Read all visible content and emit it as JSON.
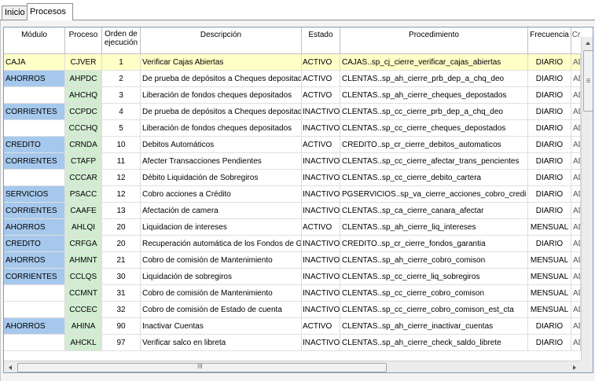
{
  "tabs": [
    {
      "label": "Inicio",
      "active": false
    },
    {
      "label": "Procesos",
      "active": true
    }
  ],
  "table": {
    "columns": {
      "modulo": "Módulo",
      "proceso": "Proceso",
      "orden": "Orden de ejecución",
      "descripcion": "Descripción",
      "estado": "Estado",
      "procedimiento": "Procedimiento",
      "frecuencia": "Frecuencia",
      "cr": "Cr"
    },
    "rows": [
      {
        "modulo": "CAJA",
        "proceso": "CJVER",
        "orden": "1",
        "descripcion": "Verificar Cajas Abiertas",
        "estado": "ACTIVO",
        "procedimiento": "CAJAS..sp_cj_cierre_verificar_cajas_abiertas",
        "frecuencia": "DIARIO",
        "cr": "AD"
      },
      {
        "modulo": "AHORROS",
        "proceso": "AHPDC",
        "orden": "2",
        "descripcion": "De prueba de depósitos a Cheques depositados",
        "estado": "ACTIVO",
        "procedimiento": "CLENTAS..sp_ah_cierre_prb_dep_a_chq_deo",
        "frecuencia": "DIARIO",
        "cr": "AD"
      },
      {
        "modulo": "",
        "proceso": "AHCHQ",
        "orden": "3",
        "descripcion": "Liberación de fondos cheques depositados",
        "estado": "ACTIVO",
        "procedimiento": "CLENTAS..sp_ah_cierre_cheques_depostados",
        "frecuencia": "DIARIO",
        "cr": "AD"
      },
      {
        "modulo": "CORRIENTES",
        "proceso": "CCPDC",
        "orden": "4",
        "descripcion": "De prueba de depósitos a Cheques depositados",
        "estado": "INACTIVO",
        "procedimiento": "CLENTAS..sp_cc_cierre_prb_dep_a_chq_deo",
        "frecuencia": "DIARIO",
        "cr": "AD"
      },
      {
        "modulo": "",
        "proceso": "CCCHQ",
        "orden": "5",
        "descripcion": "Liberación de fondos cheques depositados",
        "estado": "INACTIVO",
        "procedimiento": "CLENTAS..sp_cc_cierre_cheques_depostados",
        "frecuencia": "DIARIO",
        "cr": "AD"
      },
      {
        "modulo": "CREDITO",
        "proceso": "CRNDA",
        "orden": "10",
        "descripcion": "Debitos Automáticos",
        "estado": "ACTIVO",
        "procedimiento": "CREDITO..sp_cr_cierre_debitos_automaticos",
        "frecuencia": "DIARIO",
        "cr": "AD"
      },
      {
        "modulo": "CORRIENTES",
        "proceso": "CTAFP",
        "orden": "11",
        "descripcion": "Afecter Transacciones Pendientes",
        "estado": "INACTIVO",
        "procedimiento": "CLENTAS..sp_cc_cierre_afectar_trans_pencientes",
        "frecuencia": "DIARIO",
        "cr": "AD"
      },
      {
        "modulo": "",
        "proceso": "CCCAR",
        "orden": "12",
        "descripcion": "Débito Liquidación de Sobregiros",
        "estado": "INACTIVO",
        "procedimiento": "CLENTAS..sp_cc_cierre_debito_cartera",
        "frecuencia": "DIARIO",
        "cr": "AD"
      },
      {
        "modulo": "SERVICIOS",
        "proceso": "PSACC",
        "orden": "12",
        "descripcion": "Cobro acciones a Crédito",
        "estado": "INACTIVO",
        "procedimiento": "PGSERVICIOS..sp_va_cierre_acciones_cobro_credi",
        "frecuencia": "DIARIO",
        "cr": "AD"
      },
      {
        "modulo": "CORRIENTES",
        "proceso": "CAAFE",
        "orden": "13",
        "descripcion": "Afectación de camera",
        "estado": "INACTIVO",
        "procedimiento": "CLENTAS..sp_ca_cierre_canara_afectar",
        "frecuencia": "DIARIO",
        "cr": "AD"
      },
      {
        "modulo": "AHORROS",
        "proceso": "AHLQI",
        "orden": "20",
        "descripcion": "Liquidacion de intereses",
        "estado": "ACTIVO",
        "procedimiento": "CLENTAS..sp_ah_cierre_liq_intereses",
        "frecuencia": "MENSUAL",
        "cr": "AD"
      },
      {
        "modulo": "CREDITO",
        "proceso": "CRFGA",
        "orden": "20",
        "descripcion": "Recuperación automática de los Fondos de Garantía",
        "estado": "INACTIVO",
        "procedimiento": "CREDITO..sp_cr_cierre_fondos_garantia",
        "frecuencia": "DIARIO",
        "cr": "AD"
      },
      {
        "modulo": "AHORROS",
        "proceso": "AHMNT",
        "orden": "21",
        "descripcion": "Cobro de comisión de Mantenimiento",
        "estado": "INACTIVO",
        "procedimiento": "CLENTAS..sp_ah_cierre_cobro_comison",
        "frecuencia": "MENSUAL",
        "cr": "AD"
      },
      {
        "modulo": "CORRIENTES",
        "proceso": "CCLQS",
        "orden": "30",
        "descripcion": "Liquidación de sobregiros",
        "estado": "INACTIVO",
        "procedimiento": "CLENTAS..sp_cc_cierre_liq_sobregiros",
        "frecuencia": "MENSUAL",
        "cr": "AD"
      },
      {
        "modulo": "",
        "proceso": "CCMNT",
        "orden": "31",
        "descripcion": "Cobro de comisión de Mantenimiento",
        "estado": "INACTIVO",
        "procedimiento": "CLENTAS..sp_cc_cierre_cobro_comison",
        "frecuencia": "MENSUAL",
        "cr": "AD"
      },
      {
        "modulo": "",
        "proceso": "CCCEC",
        "orden": "32",
        "descripcion": "Cobro de comisión de Estado de cuenta",
        "estado": "INACTIVO",
        "procedimiento": "CLENTAS..sp_cc_cierre_cobro_comison_est_cta",
        "frecuencia": "MENSUAL",
        "cr": "AD"
      },
      {
        "modulo": "AHORROS",
        "proceso": "AHINA",
        "orden": "90",
        "descripcion": "Inactivar Cuentas",
        "estado": "ACTIVO",
        "procedimiento": "CLENTAS..sp_ah_cierre_inactivar_cuentas",
        "frecuencia": "DIARIO",
        "cr": "AD"
      },
      {
        "modulo": "",
        "proceso": "AHCKL",
        "orden": "97",
        "descripcion": "Verificar salco en libreta",
        "estado": "INACTIVO",
        "procedimiento": "CLENTAS..sp_ah_cierre_check_saldo_librete",
        "frecuencia": "DIARIO",
        "cr": "AD"
      }
    ]
  },
  "colors": {
    "modulo_bg": "#a6c8ec",
    "proceso_bg": "#d2ecd2",
    "selected_row_bg": "#ffffc8"
  },
  "scrollbar": {
    "grip_label": "III"
  }
}
